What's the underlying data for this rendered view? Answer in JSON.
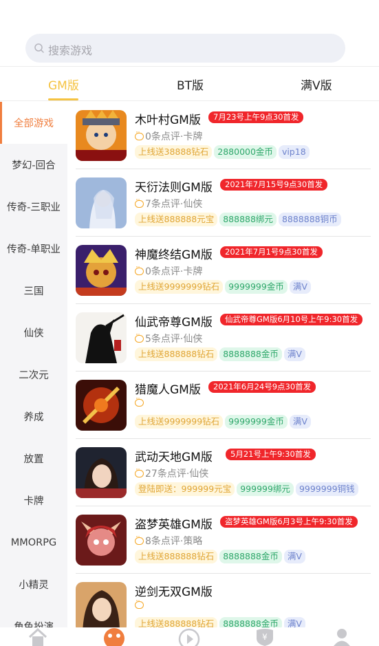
{
  "search": {
    "placeholder": "搜索游戏"
  },
  "tabs": [
    {
      "label": "GM版",
      "active": true
    },
    {
      "label": "BT版",
      "active": false
    },
    {
      "label": "满V版",
      "active": false
    }
  ],
  "categories": [
    {
      "label": "全部游戏",
      "active": true
    },
    {
      "label": "梦幻-回合"
    },
    {
      "label": "传奇-三职业"
    },
    {
      "label": "传奇-单职业"
    },
    {
      "label": "三国"
    },
    {
      "label": "仙侠"
    },
    {
      "label": "二次元"
    },
    {
      "label": "养成"
    },
    {
      "label": "放置"
    },
    {
      "label": "卡牌"
    },
    {
      "label": "MMORPG"
    },
    {
      "label": "小精灵"
    },
    {
      "label": "角色扮演"
    }
  ],
  "games": [
    {
      "name": "木叶村GM版",
      "launch": "7月23号上午9点30首发",
      "reviews": "0条点评·卡牌",
      "tags": [
        {
          "text": "上线送38888钻石",
          "style": "y"
        },
        {
          "text": "2880000金币",
          "style": "g"
        },
        {
          "text": "vip18",
          "style": "b"
        }
      ]
    },
    {
      "name": "天衍法则GM版",
      "launch": "2021年7月15号9点30首发",
      "reviews": "7条点评·仙侠",
      "tags": [
        {
          "text": "上线送888888元宝",
          "style": "y"
        },
        {
          "text": "888888绑元",
          "style": "g"
        },
        {
          "text": "8888888铜币",
          "style": "b"
        }
      ]
    },
    {
      "name": "神魔终结GM版",
      "launch": "2021年7月1号9点30首发",
      "reviews": "0条点评·卡牌",
      "tags": [
        {
          "text": "上线送9999999钻石",
          "style": "y"
        },
        {
          "text": "9999999金币",
          "style": "g"
        },
        {
          "text": "满V",
          "style": "b"
        }
      ]
    },
    {
      "name": "仙武帝尊GM版",
      "launch": "仙武帝尊GM版6月10号上午9:30首发",
      "reviews": "5条点评·仙侠",
      "tags": [
        {
          "text": "上线送888888钻石",
          "style": "y"
        },
        {
          "text": "8888888金币",
          "style": "g"
        },
        {
          "text": "满V",
          "style": "b"
        }
      ]
    },
    {
      "name": "猎魔人GM版",
      "launch": "2021年6月24号9点30首发",
      "reviews": "",
      "tags": [
        {
          "text": "上线送9999999钻石",
          "style": "y"
        },
        {
          "text": "9999999金币",
          "style": "g"
        },
        {
          "text": "满V",
          "style": "b"
        }
      ]
    },
    {
      "name": "武动天地GM版",
      "launch": "5月21号上午9:30首发",
      "reviews": "27条点评·仙侠",
      "tags": [
        {
          "text": "登陆即送：999999元宝",
          "style": "y"
        },
        {
          "text": "999999绑元",
          "style": "g"
        },
        {
          "text": "9999999铜钱",
          "style": "b"
        }
      ]
    },
    {
      "name": "盗梦英雄GM版",
      "launch": "盗梦英雄GM版6月3号上午9:30首发",
      "reviews": "8条点评·策略",
      "tags": [
        {
          "text": "上线送888888钻石",
          "style": "y"
        },
        {
          "text": "8888888金币",
          "style": "g"
        },
        {
          "text": "满V",
          "style": "b"
        }
      ]
    },
    {
      "name": "逆剑无双GM版",
      "launch": "",
      "reviews": "",
      "tags": [
        {
          "text": "上线送888888钻石",
          "style": "y"
        },
        {
          "text": "8888888金币",
          "style": "g"
        },
        {
          "text": "满V",
          "style": "b"
        }
      ]
    }
  ],
  "bottom_nav": [
    {
      "icon": "home-icon",
      "active": false
    },
    {
      "icon": "game-icon",
      "active": true
    },
    {
      "icon": "play-icon",
      "active": false
    },
    {
      "icon": "coupon-icon",
      "active": false
    },
    {
      "icon": "user-icon",
      "active": false
    }
  ],
  "colors": {
    "accent": "#f5c342",
    "active_category": "#f07e3e",
    "launch_badge": "#f0262b"
  }
}
